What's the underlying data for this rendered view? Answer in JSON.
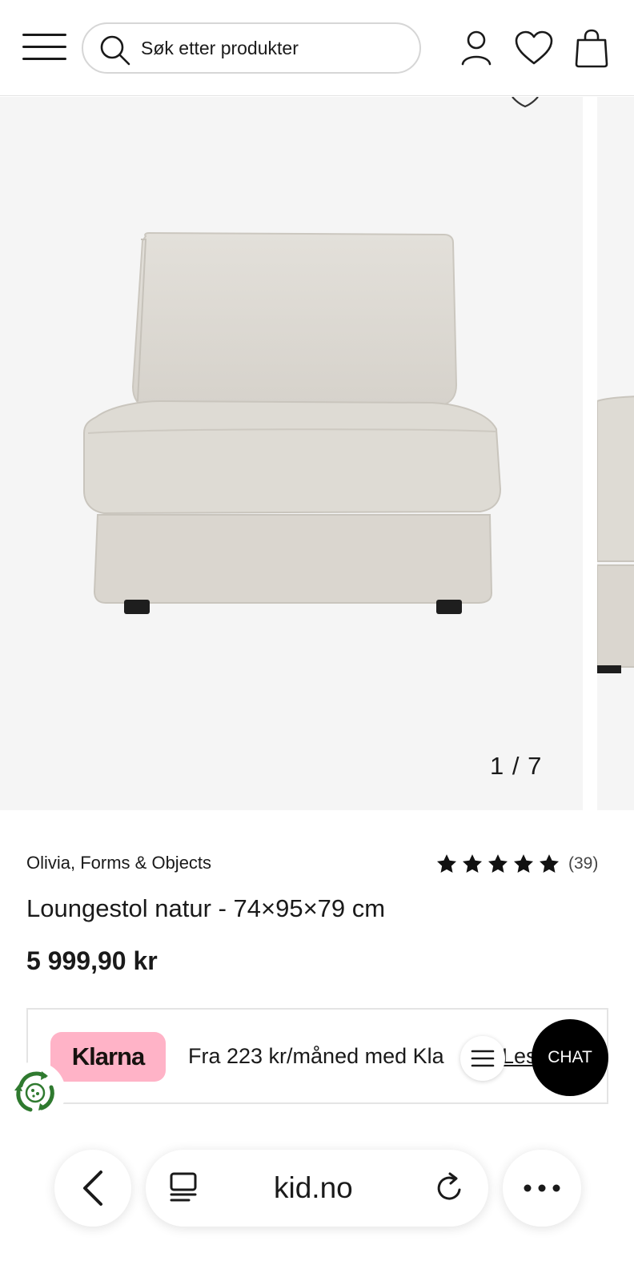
{
  "header": {
    "search_placeholder": "Søk etter produkter",
    "icons": [
      "menu-icon",
      "search-icon",
      "account-icon",
      "heart-icon",
      "shopping-bag-icon"
    ]
  },
  "gallery": {
    "counter": "1 / 7",
    "current_index": 1,
    "total": 7
  },
  "product": {
    "brand": "Olivia, Forms & Objects",
    "rating_stars": 5,
    "rating_count": "(39)",
    "title": "Loungestol natur - 74×95×79 cm",
    "price": "5 999,90 kr"
  },
  "klarna": {
    "logo": "Klarna",
    "text": "Fra 223 kr/måned med Kla",
    "link": "Les",
    "logo_color": "#ffb3c7"
  },
  "chat": {
    "label": "CHAT"
  },
  "browser": {
    "url": "kid.no"
  },
  "colors": {
    "background": "#ffffff",
    "image_bg": "#f5f5f5",
    "text": "#1a1a1a",
    "chat_bg": "#000000"
  }
}
